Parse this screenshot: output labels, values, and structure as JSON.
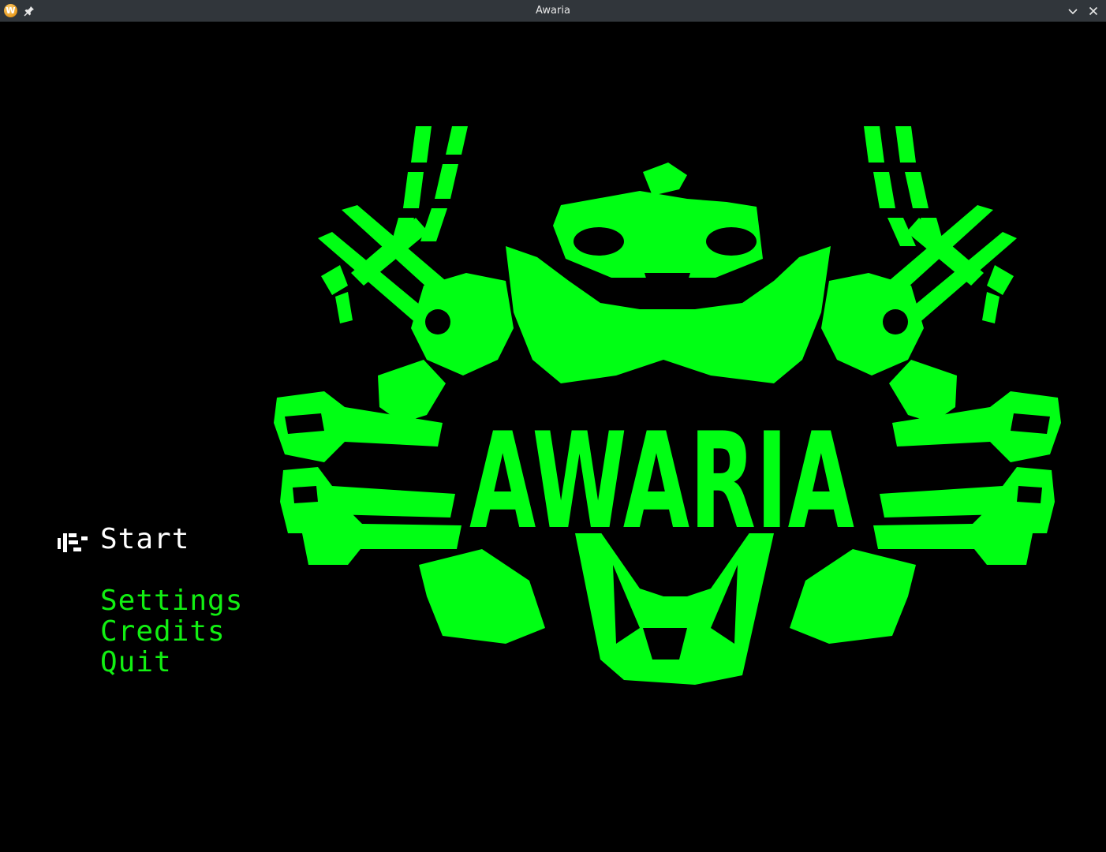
{
  "window": {
    "title": "Awaria",
    "app_icon_letter": "W"
  },
  "logo": {
    "title": "AWARIA",
    "color": "#00ff14",
    "icon": "skull-wrenches-emblem"
  },
  "menu": {
    "items": [
      {
        "label": "Start",
        "selected": true
      },
      {
        "label": "Settings",
        "selected": false
      },
      {
        "label": "Credits",
        "selected": false
      },
      {
        "label": "Quit",
        "selected": false
      }
    ],
    "selected_color": "#ffffff",
    "item_color": "#12f012",
    "cursor_icon": "selection-cursor-icon"
  },
  "colors": {
    "background": "#000000",
    "titlebar": "#31363b"
  }
}
